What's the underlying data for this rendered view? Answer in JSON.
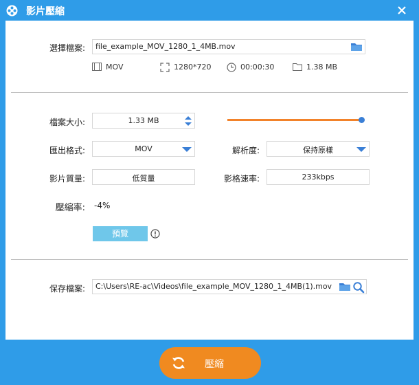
{
  "window": {
    "title": "影片壓縮",
    "app_icon": "film-reel-icon",
    "close_icon": "close-icon"
  },
  "source": {
    "label": "選擇檔案:",
    "file_path": "file_example_MOV_1280_1_4MB.mov",
    "folder_icon": "folder-icon"
  },
  "info": {
    "format": "MOV",
    "resolution": "1280*720",
    "duration": "00:00:30",
    "size": "1.38 MB"
  },
  "settings": {
    "file_size_label": "檔案大小:",
    "file_size_value": "1.33 MB",
    "size_slider_fraction": 1.0,
    "export_format_label": "匯出格式:",
    "export_format_value": "MOV",
    "resolution_label": "解析度:",
    "resolution_value": "保持原樣",
    "quality_label": "影片質量:",
    "quality_value": "低質量",
    "bitrate_label": "影格速率:",
    "bitrate_value": "233kbps",
    "ratio_label": "壓縮率:",
    "ratio_value": "-4%",
    "preview_label": "預覽"
  },
  "output": {
    "label": "保存檔案:",
    "path": "C:\\Users\\RE-ac\\Videos\\file_example_MOV_1280_1_4MB(1).mov"
  },
  "action": {
    "compress_label": "壓縮"
  },
  "colors": {
    "accent_blue": "#2f9ce8",
    "orange": "#f08a20",
    "preview_blue": "#6fc7ea",
    "arrow_blue": "#3a7fd6"
  }
}
